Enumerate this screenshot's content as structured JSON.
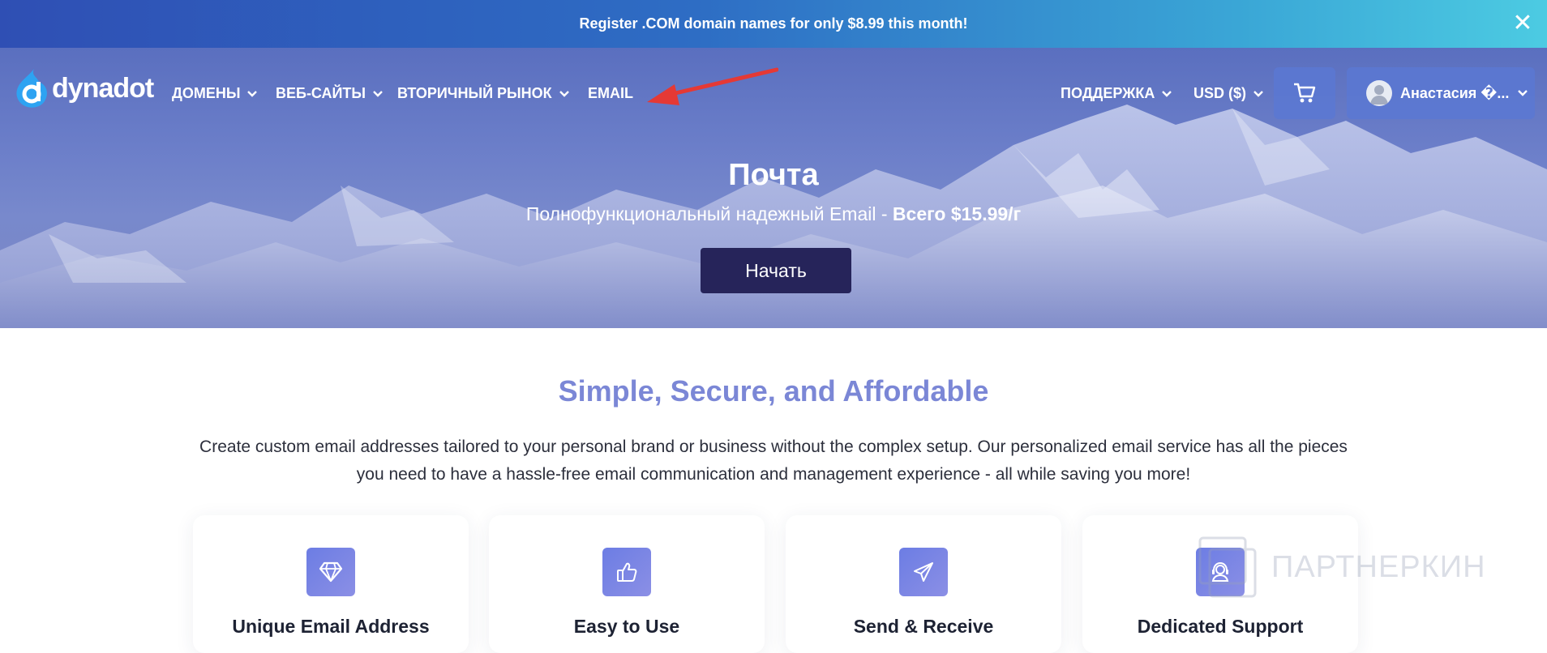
{
  "promo": {
    "text": "Register .COM domain names for only $8.99 this month!",
    "close_icon": "close-icon"
  },
  "brand": {
    "name": "dynadot",
    "accent": "#2ea3f2"
  },
  "nav": {
    "items": [
      {
        "label": "ДОМЕНЫ",
        "has_dropdown": true
      },
      {
        "label": "ВЕБ-САЙТЫ",
        "has_dropdown": true
      },
      {
        "label": "ВТОРИЧНЫЙ РЫНОК",
        "has_dropdown": true
      },
      {
        "label": "EMAIL",
        "has_dropdown": false
      }
    ],
    "support_label": "ПОДДЕРЖКА",
    "currency_label": "USD ($)",
    "cart_icon": "cart-icon",
    "user_name": "Анастасия �..."
  },
  "hero": {
    "title": "Почта",
    "subtitle_prefix": "Полнофункциональный надежный Email - ",
    "subtitle_price": "Всего $15.99/г",
    "cta_label": "Начать"
  },
  "section": {
    "title": "Simple, Secure, and Affordable",
    "description": "Create custom email addresses tailored to your personal brand or business without the complex setup. Our personalized email service has all the pieces you need to have a hassle-free email communication and management experience - all while saving you more!"
  },
  "features": [
    {
      "title": "Unique Email Address",
      "icon": "diamond-icon"
    },
    {
      "title": "Easy to Use",
      "icon": "thumbs-up-icon"
    },
    {
      "title": "Send & Receive",
      "icon": "paper-plane-icon"
    },
    {
      "title": "Dedicated Support",
      "icon": "support-agent-icon"
    }
  ],
  "watermark": {
    "text": "ПАРТНЕРКИН"
  },
  "colors": {
    "section_title": "#7b87d6",
    "cta_bg": "#26245a",
    "card_icon_bg": "#6c7de4",
    "annotation_arrow": "#e53935"
  }
}
